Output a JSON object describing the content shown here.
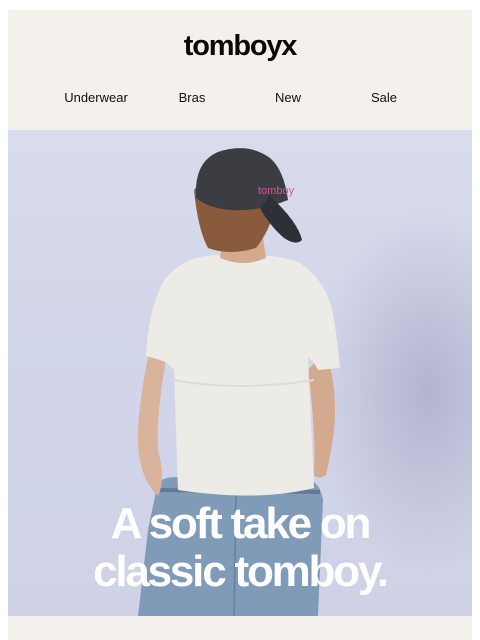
{
  "brand": {
    "logo_text": "tomboyx"
  },
  "nav": {
    "items": [
      "Underwear",
      "Bras",
      "New",
      "Sale"
    ]
  },
  "hero": {
    "headline_line1": "A soft take on",
    "headline_line2": "classic tomboy.",
    "cap_logo_text": "tomboy",
    "colors": {
      "background": "#d5d8ea",
      "shirt": "#ecebe6",
      "jeans": "#7f9bb8",
      "cap": "#3b3d42"
    }
  },
  "colors": {
    "header_background": "#f4f0ec",
    "text": "#111111"
  }
}
